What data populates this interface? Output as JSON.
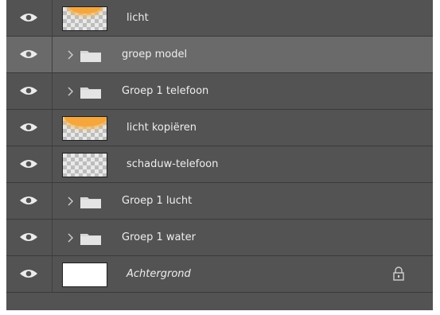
{
  "layers": [
    {
      "name": "licht",
      "kind": "image",
      "thumb": "orange-glow-transparent",
      "visible": true,
      "selected": false
    },
    {
      "name": "groep model",
      "kind": "group",
      "visible": true,
      "selected": true
    },
    {
      "name": "Groep 1  telefoon",
      "kind": "group",
      "visible": true,
      "selected": false
    },
    {
      "name": "licht kopiëren",
      "kind": "image",
      "thumb": "orange-glow-full",
      "visible": true,
      "selected": false
    },
    {
      "name": "schaduw-telefoon",
      "kind": "image",
      "thumb": "transparent",
      "visible": true,
      "selected": false
    },
    {
      "name": "Groep 1 lucht",
      "kind": "group",
      "visible": true,
      "selected": false
    },
    {
      "name": "Groep 1 water",
      "kind": "group",
      "visible": true,
      "selected": false
    },
    {
      "name": "Achtergrond",
      "kind": "background",
      "thumb": "white",
      "visible": true,
      "selected": false,
      "locked": true
    }
  ],
  "icons": {
    "visibility": "eye-icon",
    "expand": "chevron-right-icon",
    "group": "folder-icon",
    "lock": "lock-icon"
  },
  "colors": {
    "panel": "#535353",
    "selected_row": "#6a6a6a",
    "text": "#eeeeee",
    "glow": "#f5a63c"
  }
}
